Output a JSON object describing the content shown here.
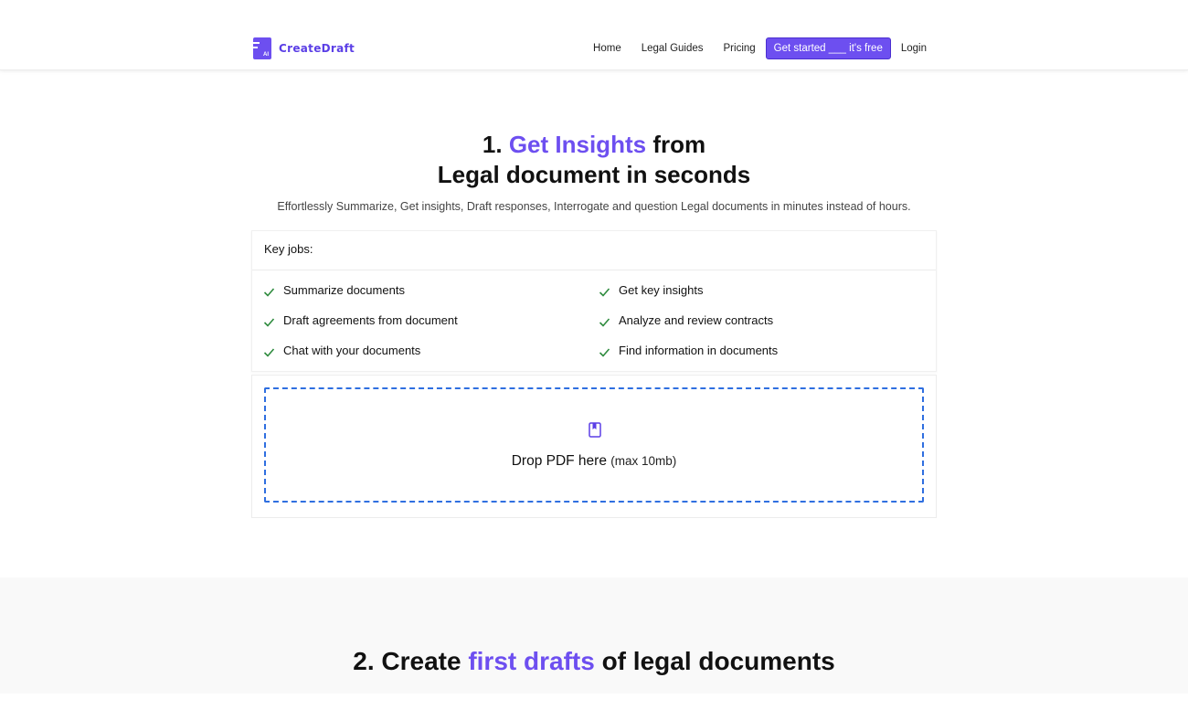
{
  "header": {
    "brand": "CreateDraft",
    "logo_badge": "AI",
    "nav": {
      "home": "Home",
      "legal_guides": "Legal Guides",
      "pricing": "Pricing",
      "cta": "Get started ___ it's free",
      "login": "Login"
    }
  },
  "hero": {
    "title_prefix": "1.",
    "title_accent": "Get Insights",
    "title_suffix": "from",
    "title_line2": "Legal document in seconds",
    "subtitle": "Effortlessly Summarize, Get insights, Draft responses, Interrogate and question Legal documents in minutes instead of hours."
  },
  "key_jobs": {
    "heading": "Key jobs:",
    "items": [
      "Summarize documents",
      "Get key insights",
      "Draft agreements from document",
      "Analyze and review contracts",
      "Chat with your documents",
      "Find information in documents"
    ]
  },
  "dropzone": {
    "label": "Drop PDF here",
    "limit": "(max 10mb)"
  },
  "section2": {
    "title_prefix": "2. Create",
    "title_accent": "first drafts",
    "title_suffix": "of legal documents"
  },
  "colors": {
    "accent": "#6d4ff0",
    "check": "#2e8b3e",
    "dashed_border": "#2f6fe0"
  }
}
